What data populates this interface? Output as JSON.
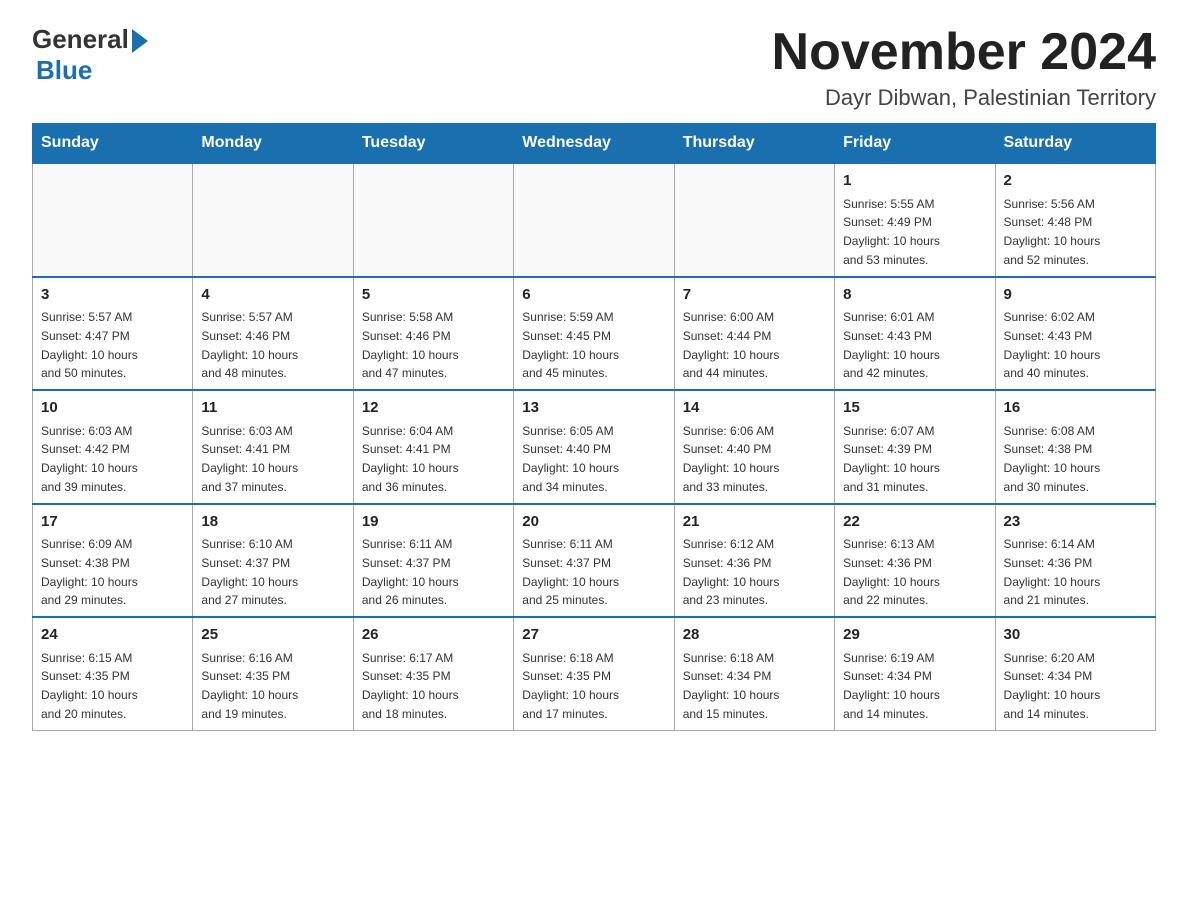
{
  "header": {
    "logo_general": "General",
    "logo_blue": "Blue",
    "title": "November 2024",
    "subtitle": "Dayr Dibwan, Palestinian Territory"
  },
  "calendar": {
    "days_of_week": [
      "Sunday",
      "Monday",
      "Tuesday",
      "Wednesday",
      "Thursday",
      "Friday",
      "Saturday"
    ],
    "weeks": [
      [
        {
          "day": "",
          "info": ""
        },
        {
          "day": "",
          "info": ""
        },
        {
          "day": "",
          "info": ""
        },
        {
          "day": "",
          "info": ""
        },
        {
          "day": "",
          "info": ""
        },
        {
          "day": "1",
          "info": "Sunrise: 5:55 AM\nSunset: 4:49 PM\nDaylight: 10 hours\nand 53 minutes."
        },
        {
          "day": "2",
          "info": "Sunrise: 5:56 AM\nSunset: 4:48 PM\nDaylight: 10 hours\nand 52 minutes."
        }
      ],
      [
        {
          "day": "3",
          "info": "Sunrise: 5:57 AM\nSunset: 4:47 PM\nDaylight: 10 hours\nand 50 minutes."
        },
        {
          "day": "4",
          "info": "Sunrise: 5:57 AM\nSunset: 4:46 PM\nDaylight: 10 hours\nand 48 minutes."
        },
        {
          "day": "5",
          "info": "Sunrise: 5:58 AM\nSunset: 4:46 PM\nDaylight: 10 hours\nand 47 minutes."
        },
        {
          "day": "6",
          "info": "Sunrise: 5:59 AM\nSunset: 4:45 PM\nDaylight: 10 hours\nand 45 minutes."
        },
        {
          "day": "7",
          "info": "Sunrise: 6:00 AM\nSunset: 4:44 PM\nDaylight: 10 hours\nand 44 minutes."
        },
        {
          "day": "8",
          "info": "Sunrise: 6:01 AM\nSunset: 4:43 PM\nDaylight: 10 hours\nand 42 minutes."
        },
        {
          "day": "9",
          "info": "Sunrise: 6:02 AM\nSunset: 4:43 PM\nDaylight: 10 hours\nand 40 minutes."
        }
      ],
      [
        {
          "day": "10",
          "info": "Sunrise: 6:03 AM\nSunset: 4:42 PM\nDaylight: 10 hours\nand 39 minutes."
        },
        {
          "day": "11",
          "info": "Sunrise: 6:03 AM\nSunset: 4:41 PM\nDaylight: 10 hours\nand 37 minutes."
        },
        {
          "day": "12",
          "info": "Sunrise: 6:04 AM\nSunset: 4:41 PM\nDaylight: 10 hours\nand 36 minutes."
        },
        {
          "day": "13",
          "info": "Sunrise: 6:05 AM\nSunset: 4:40 PM\nDaylight: 10 hours\nand 34 minutes."
        },
        {
          "day": "14",
          "info": "Sunrise: 6:06 AM\nSunset: 4:40 PM\nDaylight: 10 hours\nand 33 minutes."
        },
        {
          "day": "15",
          "info": "Sunrise: 6:07 AM\nSunset: 4:39 PM\nDaylight: 10 hours\nand 31 minutes."
        },
        {
          "day": "16",
          "info": "Sunrise: 6:08 AM\nSunset: 4:38 PM\nDaylight: 10 hours\nand 30 minutes."
        }
      ],
      [
        {
          "day": "17",
          "info": "Sunrise: 6:09 AM\nSunset: 4:38 PM\nDaylight: 10 hours\nand 29 minutes."
        },
        {
          "day": "18",
          "info": "Sunrise: 6:10 AM\nSunset: 4:37 PM\nDaylight: 10 hours\nand 27 minutes."
        },
        {
          "day": "19",
          "info": "Sunrise: 6:11 AM\nSunset: 4:37 PM\nDaylight: 10 hours\nand 26 minutes."
        },
        {
          "day": "20",
          "info": "Sunrise: 6:11 AM\nSunset: 4:37 PM\nDaylight: 10 hours\nand 25 minutes."
        },
        {
          "day": "21",
          "info": "Sunrise: 6:12 AM\nSunset: 4:36 PM\nDaylight: 10 hours\nand 23 minutes."
        },
        {
          "day": "22",
          "info": "Sunrise: 6:13 AM\nSunset: 4:36 PM\nDaylight: 10 hours\nand 22 minutes."
        },
        {
          "day": "23",
          "info": "Sunrise: 6:14 AM\nSunset: 4:36 PM\nDaylight: 10 hours\nand 21 minutes."
        }
      ],
      [
        {
          "day": "24",
          "info": "Sunrise: 6:15 AM\nSunset: 4:35 PM\nDaylight: 10 hours\nand 20 minutes."
        },
        {
          "day": "25",
          "info": "Sunrise: 6:16 AM\nSunset: 4:35 PM\nDaylight: 10 hours\nand 19 minutes."
        },
        {
          "day": "26",
          "info": "Sunrise: 6:17 AM\nSunset: 4:35 PM\nDaylight: 10 hours\nand 18 minutes."
        },
        {
          "day": "27",
          "info": "Sunrise: 6:18 AM\nSunset: 4:35 PM\nDaylight: 10 hours\nand 17 minutes."
        },
        {
          "day": "28",
          "info": "Sunrise: 6:18 AM\nSunset: 4:34 PM\nDaylight: 10 hours\nand 15 minutes."
        },
        {
          "day": "29",
          "info": "Sunrise: 6:19 AM\nSunset: 4:34 PM\nDaylight: 10 hours\nand 14 minutes."
        },
        {
          "day": "30",
          "info": "Sunrise: 6:20 AM\nSunset: 4:34 PM\nDaylight: 10 hours\nand 14 minutes."
        }
      ]
    ]
  }
}
